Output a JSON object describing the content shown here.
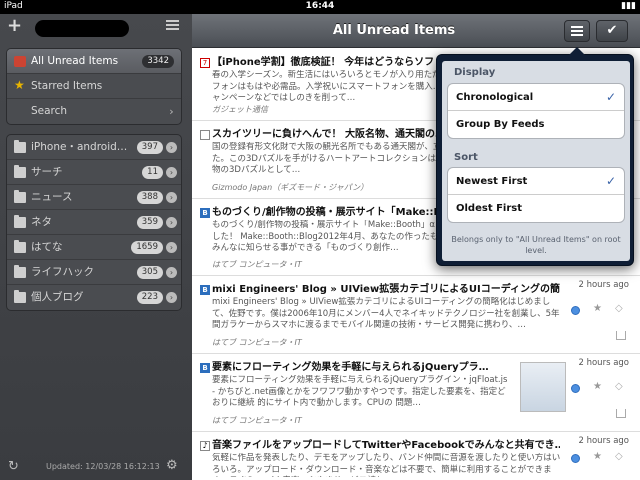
{
  "status": {
    "carrier": "iPad",
    "time": "16:44"
  },
  "sidebar": {
    "items": [
      {
        "label": "All Unread Items",
        "count": "3342",
        "icon": "feed-icon"
      },
      {
        "label": "Starred Items",
        "icon": "star-icon"
      },
      {
        "label": "Search",
        "icon": "search-icon"
      }
    ],
    "folders": [
      {
        "label": "iPhone・android…",
        "count": "397"
      },
      {
        "label": "サーチ",
        "count": "11"
      },
      {
        "label": "ニュース",
        "count": "388"
      },
      {
        "label": "ネタ",
        "count": "359"
      },
      {
        "label": "はてな",
        "count": "1659"
      },
      {
        "label": "ライフハック",
        "count": "305"
      },
      {
        "label": "個人ブログ",
        "count": "223"
      }
    ],
    "updated": "Updated: 12/03/28 16:12:13"
  },
  "header": {
    "title": "All Unread Items"
  },
  "articles": [
    {
      "favicon": "7",
      "title": "【iPhone学割】徹底検証！ 今年はどうならソフトバンク…",
      "summary": "春の入学シーズン。新生活にはいろいろとモノが入り用ただきますよね。とって、スマートフォンはもはや必需品。入学祝いにスマートフォンを購入…もあることだろう。各社学割キャンペーンなどではしのきを削って…",
      "source": "ガジェット通信",
      "time": ""
    },
    {
      "favicon": "",
      "title": "スカイツリーに負けへんで！ 大阪名物、通天閣の…",
      "summary": "国の登録有形文化財で大阪の観光名所でもある通天閣が、立体パズルとして発売されました。この3Dパズルを手がけるハートアートコレクションは、世界遺産や世界の有名な建築物の3Dパズルとして…",
      "source": "Gizmodo Japan（ギズモード・ジャパン）",
      "time": ""
    },
    {
      "favicon": "B",
      "title": "ものづくり/創作物の投稿・展示サイト「Make::Bo…",
      "summary": "ものづくり/創作物の投稿・展示サイト「Make::Booth」αますねリリースしました！ Make::Booth::Blog2012年4月、あなたの作ったもの、みんな物でもみんなに知らせる事ができる「ものづくり創作…",
      "source": "はてブ コンピュータ・IT",
      "time": ""
    },
    {
      "favicon": "B",
      "title": "mixi Engineers' Blog » UIView拡張カテゴリによるUIコーディングの簡略化",
      "summary": "mixi Engineers' Blog » UIView拡張カテゴリによるUIコーディングの簡略化はじめまして、佐野です。僕は2006年10月にメンバー4人でネイキッドテクノロジー社を創業し、5年間ガラケーからスマホに渡るまでモバイル関連の技術・サービス開発に携わり、…",
      "source": "はてブ コンピュータ・IT",
      "time": "2 hours ago"
    },
    {
      "favicon": "B",
      "title": "要素にフローティング効果を手軽に与えられるjQueryプラ…",
      "summary": "要素にフローティング効果を手軽に与えられるjQueryプラグイン・jqFloat.js - かちびと.net画像とかをフワフワ動かすやつです。指定した要素を、指定どおりに継続 的にサイト内で動かします。CPUの 問題…",
      "source": "はてブ コンピュータ・IT",
      "time": "2 hours ago"
    },
    {
      "favicon": "♪",
      "title": "音楽ファイルをアップロードしてTwitterやFacebookでみんなと共有でき…",
      "summary": "気軽に作品を発表したり、デモをアップしたり、バンド仲間に音源を渡したりと使い方はいろいろ。アップロード・ダウンロード・音楽などは不要で、簡単に利用することができます。 TwitSound | 音楽つぶやきサービス読む…",
      "source": "",
      "time": "2 hours ago"
    }
  ],
  "popover": {
    "display_label": "Display",
    "display_options": [
      "Chronological",
      "Group By Feeds"
    ],
    "sort_label": "Sort",
    "sort_options": [
      "Newest First",
      "Oldest First"
    ],
    "note": "Belongs only to \"All Unread Items\" on root level.",
    "selected_display": "Chronological",
    "selected_sort": "Newest First"
  },
  "colors": {
    "accent": "#3a63a8",
    "unread_dot": "#4c8fe0"
  }
}
